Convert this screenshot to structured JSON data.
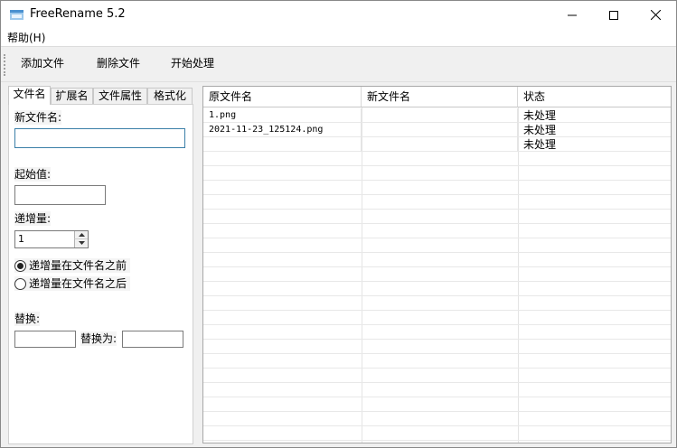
{
  "window": {
    "title": "FreeRename 5.2"
  },
  "menu": {
    "help": "帮助(H)"
  },
  "toolbar": {
    "add": "添加文件",
    "delete": "删除文件",
    "start": "开始处理"
  },
  "tabs": [
    {
      "label": "文件名",
      "active": true
    },
    {
      "label": "扩展名",
      "active": false
    },
    {
      "label": "文件属性",
      "active": false
    },
    {
      "label": "格式化",
      "active": false
    }
  ],
  "panel": {
    "new_name_label": "新文件名:",
    "new_name_value": "",
    "start_label": "起始值:",
    "start_value": "",
    "increment_label": "递增量:",
    "increment_value": "1",
    "radio_before": "递增量在文件名之前",
    "radio_after": "递增量在文件名之后",
    "replace_label": "替换:",
    "replace_with_label": "替换为:",
    "replace_from_value": "",
    "replace_to_value": ""
  },
  "grid": {
    "columns": [
      "原文件名",
      "新文件名",
      "状态"
    ],
    "rows": [
      {
        "original": "1.png",
        "new": "",
        "status": "未处理"
      },
      {
        "original": "2021-11-23_125124.png",
        "new": "",
        "status": "未处理"
      },
      {
        "original": "",
        "new": "",
        "status": "未处理"
      }
    ]
  },
  "colors": {
    "focus_border": "#3b7fa8",
    "window_bg": "#f0f0f0"
  }
}
